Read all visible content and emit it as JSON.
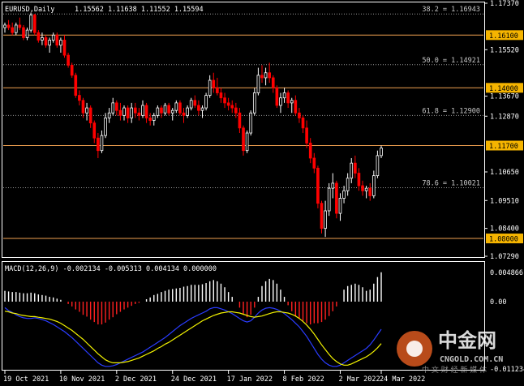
{
  "colors": {
    "background": "#000000",
    "bull": "#ffffff",
    "bear": "#ff0000",
    "level": "#f0a050",
    "fib": "#9a9a9a",
    "macd_hist_pos": "#ffffff",
    "macd_hist_neg": "#ff2020",
    "macd_line": "#2a3cff",
    "signal_line": "#f2f200",
    "price_label_bg": "#f5b400"
  },
  "header": {
    "symbol": "EURUSD,Daily",
    "ohlc": "1.15562 1.11638 1.11552 1.15594"
  },
  "price_axis": {
    "ticks": [
      "1.17370",
      "1.15520",
      "1.13670",
      "1.12870",
      "1.10650",
      "1.09510",
      "1.08400",
      "1.07290"
    ]
  },
  "level_labels": [
    "1.16100",
    "1.14000",
    "1.11700",
    "1.08000"
  ],
  "fib_labels": [
    "38.2 = 1.16943",
    "50.0 = 1.14921",
    "61.8 = 1.12900",
    "78.6 = 1.10021"
  ],
  "macd": {
    "header": "MACD(12,26,9) -0.002134 -0.005313 0.004134 0.000000",
    "axis_ticks": [
      "0.004866",
      "0.00",
      "-0.011234"
    ]
  },
  "time_axis": [
    "19 Oct 2021",
    "10 Nov 2021",
    "2 Dec 2021",
    "24 Dec 2021",
    "17 Jan 2022",
    "8 Feb 2022",
    "2 Mar 2022",
    "24 Mar 2022"
  ],
  "watermark": {
    "cn_title": "中金网",
    "site": "CNGOLD.COM.CN",
    "slogan": "中 文 财 经 新 媒 体"
  },
  "chart_data": {
    "type": "candlestick",
    "title": "EURUSD,Daily",
    "symbol": "EURUSD",
    "timeframe": "Daily",
    "ylim": [
      1.0729,
      1.1737
    ],
    "horizontal_levels": [
      1.161,
      1.14,
      1.117,
      1.08
    ],
    "fibonacci_levels": [
      {
        "ratio": 38.2,
        "price": 1.16943
      },
      {
        "ratio": 50.0,
        "price": 1.14921
      },
      {
        "ratio": 61.8,
        "price": 1.129
      },
      {
        "ratio": 78.6,
        "price": 1.10021
      }
    ],
    "x_tick_labels": [
      "19 Oct 2021",
      "10 Nov 2021",
      "2 Dec 2021",
      "24 Dec 2021",
      "17 Jan 2022",
      "8 Feb 2022",
      "2 Mar 2022",
      "24 Mar 2022"
    ],
    "candles": [
      [
        1.164,
        1.166,
        1.162,
        1.165
      ],
      [
        1.165,
        1.167,
        1.163,
        1.164
      ],
      [
        1.164,
        1.166,
        1.161,
        1.162
      ],
      [
        1.162,
        1.166,
        1.161,
        1.165
      ],
      [
        1.165,
        1.168,
        1.163,
        1.164
      ],
      [
        1.164,
        1.165,
        1.159,
        1.16
      ],
      [
        1.16,
        1.164,
        1.159,
        1.163
      ],
      [
        1.163,
        1.17,
        1.162,
        1.169
      ],
      [
        1.169,
        1.1695,
        1.161,
        1.162
      ],
      [
        1.162,
        1.163,
        1.158,
        1.159
      ],
      [
        1.159,
        1.162,
        1.157,
        1.16
      ],
      [
        1.16,
        1.161,
        1.156,
        1.157
      ],
      [
        1.157,
        1.16,
        1.154,
        1.159
      ],
      [
        1.159,
        1.162,
        1.158,
        1.161
      ],
      [
        1.161,
        1.162,
        1.156,
        1.157
      ],
      [
        1.157,
        1.16,
        1.154,
        1.159
      ],
      [
        1.159,
        1.161,
        1.152,
        1.153
      ],
      [
        1.153,
        1.154,
        1.148,
        1.149
      ],
      [
        1.149,
        1.15,
        1.144,
        1.145
      ],
      [
        1.145,
        1.146,
        1.136,
        1.137
      ],
      [
        1.137,
        1.139,
        1.133,
        1.135
      ],
      [
        1.135,
        1.136,
        1.128,
        1.13
      ],
      [
        1.13,
        1.134,
        1.127,
        1.132
      ],
      [
        1.132,
        1.133,
        1.124,
        1.126
      ],
      [
        1.126,
        1.127,
        1.118,
        1.12
      ],
      [
        1.12,
        1.122,
        1.112,
        1.115
      ],
      [
        1.115,
        1.123,
        1.114,
        1.121
      ],
      [
        1.121,
        1.13,
        1.12,
        1.128
      ],
      [
        1.128,
        1.132,
        1.126,
        1.13
      ],
      [
        1.13,
        1.136,
        1.129,
        1.134
      ],
      [
        1.134,
        1.135,
        1.129,
        1.131
      ],
      [
        1.131,
        1.134,
        1.127,
        1.129
      ],
      [
        1.129,
        1.133,
        1.127,
        1.132
      ],
      [
        1.132,
        1.133,
        1.126,
        1.128
      ],
      [
        1.128,
        1.134,
        1.126,
        1.132
      ],
      [
        1.132,
        1.134,
        1.128,
        1.13
      ],
      [
        1.13,
        1.132,
        1.127,
        1.129
      ],
      [
        1.129,
        1.135,
        1.128,
        1.133
      ],
      [
        1.133,
        1.134,
        1.126,
        1.128
      ],
      [
        1.128,
        1.13,
        1.125,
        1.127
      ],
      [
        1.127,
        1.13,
        1.125,
        1.129
      ],
      [
        1.129,
        1.133,
        1.128,
        1.132
      ],
      [
        1.132,
        1.133,
        1.128,
        1.13
      ],
      [
        1.13,
        1.134,
        1.129,
        1.133
      ],
      [
        1.133,
        1.134,
        1.129,
        1.13
      ],
      [
        1.13,
        1.132,
        1.127,
        1.131
      ],
      [
        1.131,
        1.135,
        1.13,
        1.134
      ],
      [
        1.134,
        1.135,
        1.129,
        1.13
      ],
      [
        1.13,
        1.132,
        1.126,
        1.129
      ],
      [
        1.129,
        1.133,
        1.128,
        1.132
      ],
      [
        1.132,
        1.136,
        1.131,
        1.135
      ],
      [
        1.135,
        1.137,
        1.132,
        1.133
      ],
      [
        1.133,
        1.135,
        1.129,
        1.131
      ],
      [
        1.131,
        1.133,
        1.128,
        1.132
      ],
      [
        1.132,
        1.138,
        1.131,
        1.137
      ],
      [
        1.137,
        1.145,
        1.136,
        1.143
      ],
      [
        1.143,
        1.146,
        1.138,
        1.14
      ],
      [
        1.14,
        1.144,
        1.137,
        1.138
      ],
      [
        1.138,
        1.14,
        1.134,
        1.136
      ],
      [
        1.136,
        1.138,
        1.132,
        1.134
      ],
      [
        1.134,
        1.136,
        1.131,
        1.133
      ],
      [
        1.133,
        1.135,
        1.13,
        1.132
      ],
      [
        1.132,
        1.134,
        1.128,
        1.13
      ],
      [
        1.13,
        1.132,
        1.122,
        1.124
      ],
      [
        1.124,
        1.125,
        1.113,
        1.115
      ],
      [
        1.115,
        1.123,
        1.114,
        1.122
      ],
      [
        1.122,
        1.131,
        1.121,
        1.13
      ],
      [
        1.13,
        1.14,
        1.129,
        1.138
      ],
      [
        1.138,
        1.148,
        1.137,
        1.145
      ],
      [
        1.145,
        1.149,
        1.142,
        1.144
      ],
      [
        1.144,
        1.148,
        1.141,
        1.146
      ],
      [
        1.146,
        1.15,
        1.142,
        1.144
      ],
      [
        1.144,
        1.145,
        1.138,
        1.14
      ],
      [
        1.14,
        1.141,
        1.132,
        1.133
      ],
      [
        1.133,
        1.138,
        1.13,
        1.136
      ],
      [
        1.136,
        1.14,
        1.134,
        1.138
      ],
      [
        1.138,
        1.139,
        1.132,
        1.134
      ],
      [
        1.134,
        1.136,
        1.13,
        1.135
      ],
      [
        1.135,
        1.137,
        1.129,
        1.13
      ],
      [
        1.13,
        1.132,
        1.126,
        1.128
      ],
      [
        1.128,
        1.129,
        1.122,
        1.124
      ],
      [
        1.124,
        1.127,
        1.116,
        1.118
      ],
      [
        1.118,
        1.12,
        1.11,
        1.112
      ],
      [
        1.112,
        1.114,
        1.106,
        1.108
      ],
      [
        1.108,
        1.109,
        1.092,
        1.094
      ],
      [
        1.094,
        1.095,
        1.082,
        1.084
      ],
      [
        1.084,
        1.095,
        1.0806,
        1.091
      ],
      [
        1.091,
        1.102,
        1.089,
        1.1
      ],
      [
        1.1,
        1.106,
        1.096,
        1.102
      ],
      [
        1.102,
        1.103,
        1.088,
        1.09
      ],
      [
        1.09,
        1.098,
        1.087,
        1.096
      ],
      [
        1.096,
        1.101,
        1.094,
        1.099
      ],
      [
        1.099,
        1.106,
        1.097,
        1.104
      ],
      [
        1.104,
        1.112,
        1.102,
        1.11
      ],
      [
        1.11,
        1.113,
        1.104,
        1.106
      ],
      [
        1.106,
        1.108,
        1.099,
        1.101
      ],
      [
        1.101,
        1.103,
        1.097,
        1.099
      ],
      [
        1.099,
        1.101,
        1.096,
        1.1
      ],
      [
        1.1,
        1.102,
        1.095,
        1.097
      ],
      [
        1.097,
        1.107,
        1.096,
        1.105
      ],
      [
        1.105,
        1.115,
        1.104,
        1.113
      ],
      [
        1.113,
        1.117,
        1.112,
        1.116
      ]
    ],
    "macd": {
      "histogram": [
        0.0018,
        0.0017,
        0.0016,
        0.0016,
        0.0015,
        0.0014,
        0.0014,
        0.0015,
        0.0014,
        0.0012,
        0.0011,
        0.001,
        0.0008,
        0.0007,
        0.0005,
        0.0003,
        0.0,
        -0.0004,
        -0.0008,
        -0.0013,
        -0.0017,
        -0.0022,
        -0.0025,
        -0.003,
        -0.0034,
        -0.0038,
        -0.0038,
        -0.0035,
        -0.003,
        -0.0026,
        -0.0021,
        -0.0017,
        -0.0013,
        -0.001,
        -0.0007,
        -0.0004,
        -0.0002,
        0.0,
        0.0004,
        0.0007,
        0.0011,
        0.0013,
        0.0016,
        0.0018,
        0.002,
        0.0021,
        0.0022,
        0.0023,
        0.0025,
        0.0026,
        0.0028,
        0.0028,
        0.0028,
        0.0029,
        0.0031,
        0.0034,
        0.0036,
        0.0034,
        0.003,
        0.0024,
        0.0016,
        0.0008,
        0.0,
        -0.001,
        -0.0022,
        -0.0026,
        -0.0022,
        -0.001,
        0.0008,
        0.0026,
        0.0034,
        0.0038,
        0.0036,
        0.003,
        0.002,
        0.0008,
        -0.0006,
        -0.0016,
        -0.0024,
        -0.0028,
        -0.0032,
        -0.0036,
        -0.0038,
        -0.0036,
        -0.0036,
        -0.0034,
        -0.003,
        -0.0024,
        -0.0016,
        -0.0008,
        0.0,
        0.002,
        0.0026,
        0.0028,
        0.003,
        0.0028,
        0.0024,
        0.0018,
        0.002,
        0.003,
        0.0041,
        0.0049
      ],
      "macd_line": [
        -0.001,
        -0.0015,
        -0.0018,
        -0.0022,
        -0.0025,
        -0.0027,
        -0.0028,
        -0.0028,
        -0.0027,
        -0.0028,
        -0.003,
        -0.0032,
        -0.0035,
        -0.0038,
        -0.0042,
        -0.0046,
        -0.005,
        -0.0055,
        -0.006,
        -0.0066,
        -0.0072,
        -0.0078,
        -0.0084,
        -0.009,
        -0.0096,
        -0.0102,
        -0.0106,
        -0.0108,
        -0.0108,
        -0.0107,
        -0.0105,
        -0.0102,
        -0.0099,
        -0.0096,
        -0.0093,
        -0.009,
        -0.0087,
        -0.0084,
        -0.008,
        -0.0076,
        -0.0072,
        -0.0068,
        -0.0064,
        -0.006,
        -0.0055,
        -0.005,
        -0.0045,
        -0.004,
        -0.0036,
        -0.0032,
        -0.0028,
        -0.0025,
        -0.0022,
        -0.0019,
        -0.0016,
        -0.0012,
        -0.001,
        -0.001,
        -0.0012,
        -0.0014,
        -0.0017,
        -0.002,
        -0.0024,
        -0.0028,
        -0.0032,
        -0.0034,
        -0.0032,
        -0.0026,
        -0.0019,
        -0.0014,
        -0.0011,
        -0.001,
        -0.0011,
        -0.0013,
        -0.0016,
        -0.002,
        -0.0025,
        -0.003,
        -0.0036,
        -0.0042,
        -0.005,
        -0.0058,
        -0.0068,
        -0.0078,
        -0.0088,
        -0.0096,
        -0.0102,
        -0.0106,
        -0.0108,
        -0.0108,
        -0.0106,
        -0.0102,
        -0.0098,
        -0.0094,
        -0.009,
        -0.0086,
        -0.0082,
        -0.0078,
        -0.0072,
        -0.0064,
        -0.0055,
        -0.0046
      ],
      "signal_line": [
        -0.0016,
        -0.0017,
        -0.0019,
        -0.002,
        -0.0022,
        -0.0023,
        -0.0024,
        -0.0025,
        -0.0025,
        -0.0026,
        -0.0027,
        -0.0028,
        -0.0029,
        -0.0031,
        -0.0033,
        -0.0036,
        -0.004,
        -0.0044,
        -0.0048,
        -0.0053,
        -0.0058,
        -0.0063,
        -0.0069,
        -0.0075,
        -0.0081,
        -0.0087,
        -0.0092,
        -0.0097,
        -0.01,
        -0.0102,
        -0.0102,
        -0.0102,
        -0.0101,
        -0.01,
        -0.0098,
        -0.0096,
        -0.0094,
        -0.0091,
        -0.0088,
        -0.0085,
        -0.0082,
        -0.0078,
        -0.0075,
        -0.0071,
        -0.0068,
        -0.0064,
        -0.006,
        -0.0056,
        -0.0052,
        -0.0048,
        -0.0044,
        -0.004,
        -0.0036,
        -0.0032,
        -0.0029,
        -0.0026,
        -0.0023,
        -0.0021,
        -0.0019,
        -0.0018,
        -0.0017,
        -0.0017,
        -0.0018,
        -0.0019,
        -0.0021,
        -0.0023,
        -0.0025,
        -0.0026,
        -0.0025,
        -0.0024,
        -0.0022,
        -0.002,
        -0.0018,
        -0.0017,
        -0.0017,
        -0.0018,
        -0.0019,
        -0.0021,
        -0.0024,
        -0.0028,
        -0.0033,
        -0.0039,
        -0.0046,
        -0.0054,
        -0.0063,
        -0.0072,
        -0.008,
        -0.0088,
        -0.0095,
        -0.01,
        -0.0104,
        -0.0106,
        -0.0106,
        -0.0104,
        -0.0101,
        -0.0098,
        -0.0095,
        -0.0092,
        -0.0088,
        -0.0083,
        -0.0077,
        -0.007
      ]
    }
  }
}
